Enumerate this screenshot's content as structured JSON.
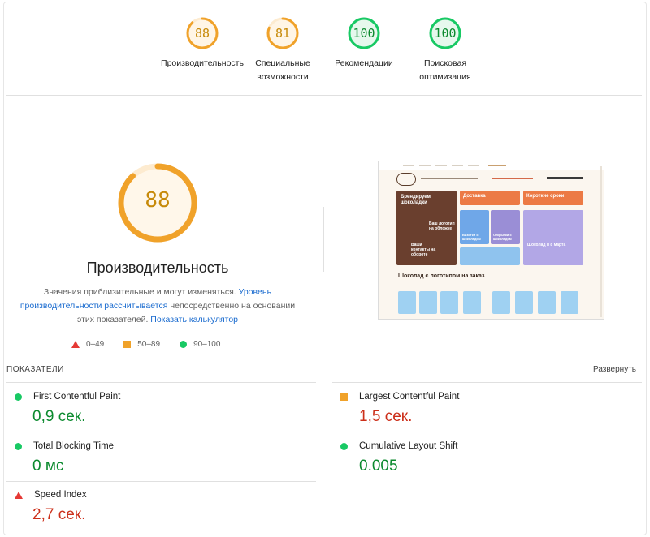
{
  "scores": [
    {
      "value": "88",
      "label": "Производительность",
      "color": "#f0a22a",
      "text_color": "#c78a0a",
      "fraction": 0.88
    },
    {
      "value": "81",
      "label": "Специальные возможности",
      "color": "#f0a22a",
      "text_color": "#c78a0a",
      "fraction": 0.81
    },
    {
      "value": "100",
      "label": "Рекомендации",
      "color": "#18c964",
      "text_color": "#0b8a2e",
      "fraction": 1.0
    },
    {
      "value": "100",
      "label": "Поисковая оптимизация",
      "color": "#18c964",
      "text_color": "#0b8a2e",
      "fraction": 1.0
    }
  ],
  "main": {
    "score": "88",
    "fraction": 0.88,
    "title": "Производительность",
    "desc_prefix": "Значения приблизительные и могут изменяться. ",
    "desc_link": "Уровень производительности рассчитывается",
    "desc_middle": " непосредственно на основании этих показателей. ",
    "calc_link": "Показать калькулятор"
  },
  "legend": {
    "poor": "0–49",
    "average": "50–89",
    "good": "90–100"
  },
  "thumbnail": {
    "card1": "Брендируем шоколадки",
    "card2": "Доставка",
    "card3": "Короткие сроки",
    "card4": "Ваш логотип на обложке",
    "card5": "Ваши контакты на обороте",
    "card6": "Визитки с шоколадом",
    "card7": "Открытки с шоколадом",
    "card8": "Шоколад в 8 марта",
    "heading": "Шоколад с логотипом на заказ"
  },
  "metrics": {
    "header": "ПОКАЗАТЕЛИ",
    "expand": "Развернуть",
    "items": [
      {
        "name": "First Contentful Paint",
        "value": "0,9 сек.",
        "status": "good"
      },
      {
        "name": "Largest Contentful Paint",
        "value": "1,5 сек.",
        "status": "average"
      },
      {
        "name": "Total Blocking Time",
        "value": "0 мс",
        "status": "good"
      },
      {
        "name": "Cumulative Layout Shift",
        "value": "0.005",
        "status": "good"
      },
      {
        "name": "Speed Index",
        "value": "2,7 сек.",
        "status": "poor"
      }
    ]
  }
}
